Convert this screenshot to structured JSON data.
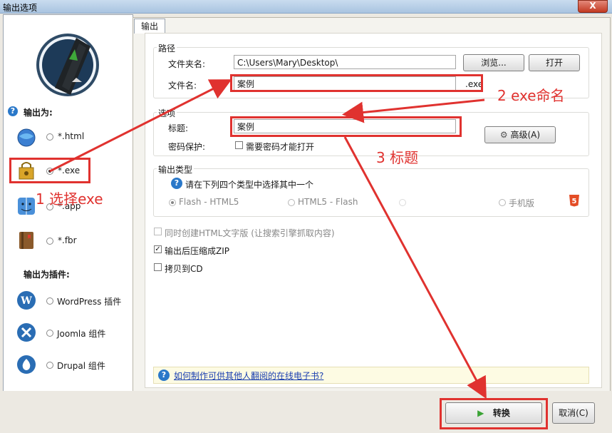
{
  "window": {
    "title": "输出选项",
    "close_label": "X"
  },
  "sidebar": {
    "output_as_label": "输出为:",
    "formats": [
      {
        "label": "*.html",
        "selected": false
      },
      {
        "label": "*.exe",
        "selected": true
      },
      {
        "label": "*.app",
        "selected": false
      },
      {
        "label": "*.fbr",
        "selected": false
      }
    ],
    "plugins_label": "输出为插件:",
    "plugins": [
      {
        "label": "WordPress 插件"
      },
      {
        "label": "Joomla 组件"
      },
      {
        "label": "Drupal 组件"
      }
    ]
  },
  "tabs": [
    "输出"
  ],
  "path": {
    "group_label": "路径",
    "folder_label": "文件夹名:",
    "folder_value": "C:\\Users\\Mary\\Desktop\\",
    "browse_label": "浏览...",
    "open_label": "打开",
    "filename_label": "文件名:",
    "filename_value": "案例",
    "ext": ".exe"
  },
  "options": {
    "group_label": "选项",
    "title_label": "标题:",
    "title_value": "案例",
    "password_label": "密码保护:",
    "password_checkbox": "需要密码才能打开",
    "advanced_label": "高级(A)"
  },
  "output_type": {
    "group_label": "输出类型",
    "hint": "请在下列四个类型中选择其中一个",
    "choices": [
      "Flash - HTML5",
      "HTML5 - Flash",
      "",
      "手机版"
    ]
  },
  "checks": [
    {
      "label": "同时创建HTML文字版 (让搜索引擎抓取内容)",
      "checked": false,
      "disabled": true
    },
    {
      "label": "输出后压缩成ZIP",
      "checked": true,
      "disabled": false
    },
    {
      "label": "拷贝到CD",
      "checked": false,
      "disabled": false
    }
  ],
  "help_link": "如何制作可供其他人翻阅的在线电子书?",
  "footer": {
    "convert_label": "转换",
    "cancel_label": "取消(C)"
  },
  "annotations": {
    "step1": "1 选择exe",
    "step2": "2 exe命名",
    "step3": "3 标题"
  }
}
